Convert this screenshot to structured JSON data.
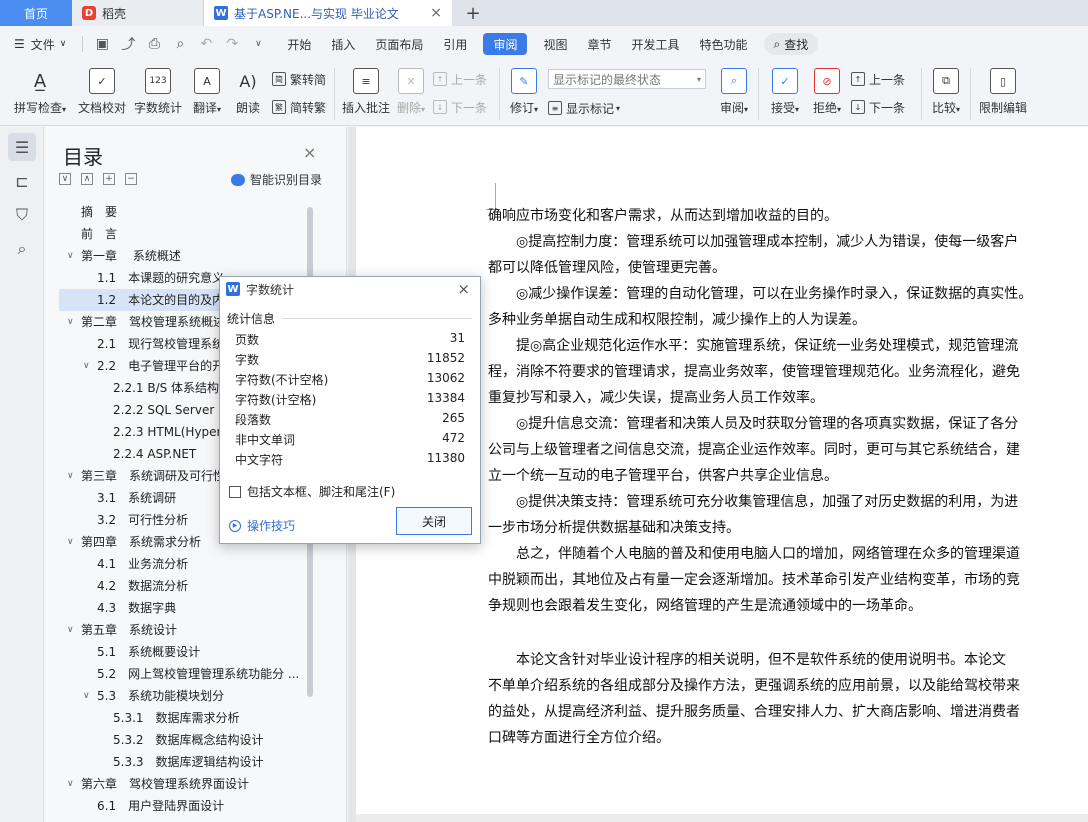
{
  "tabs": [
    {
      "label": "首页"
    },
    {
      "label": "稻壳"
    },
    {
      "label": "基于ASP.NE...与实现 毕业论文"
    }
  ],
  "menubar": {
    "file": "文件",
    "items": [
      "开始",
      "插入",
      "页面布局",
      "引用",
      "审阅",
      "视图",
      "章节",
      "开发工具",
      "特色功能"
    ],
    "active": "审阅",
    "search": "查找"
  },
  "ribbon": {
    "spell_check": "拼写检查",
    "doc_proof": "文档校对",
    "word_count": "字数统计",
    "translate": "翻译",
    "read_aloud": "朗读",
    "trad_to_simp": "繁转简",
    "simp_to_trad": "简转繁",
    "insert_comment": "插入批注",
    "delete": "删除",
    "prev_comment": "上一条",
    "next_comment": "下一条",
    "revise": "修订",
    "markup_select": "显示标记的最终状态",
    "show_markup": "显示标记",
    "review": "审阅",
    "accept": "接受",
    "reject": "拒绝",
    "prev": "上一条",
    "next": "下一条",
    "compare": "比较",
    "restrict_edit": "限制编辑"
  },
  "toc": {
    "title": "目录",
    "smart_label": "智能识别目录",
    "items": [
      {
        "text": "摘　要",
        "level": 1
      },
      {
        "text": "前　言",
        "level": 1
      },
      {
        "text": "第一章　 系统概述",
        "level": 1,
        "arrow": "∨"
      },
      {
        "text": "1.1　本课题的研究意义",
        "level": 2
      },
      {
        "text": "1.2　本论文的目的及内容",
        "level": 2,
        "selected": true
      },
      {
        "text": "第二章　驾校管理系统概述",
        "level": 1,
        "arrow": "∨"
      },
      {
        "text": "2.1　现行驾校管理系统",
        "level": 2
      },
      {
        "text": "2.2　电子管理平台的开",
        "level": 2,
        "arrow": "∨"
      },
      {
        "text": "2.2.1 B/S 体系结构",
        "level": 3
      },
      {
        "text": "2.2.2 SQL Server",
        "level": 3
      },
      {
        "text": "2.2.3 HTML(Hyper",
        "level": 3
      },
      {
        "text": "2.2.4 ASP.NET",
        "level": 3
      },
      {
        "text": "第三章　系统调研及可行性",
        "level": 1,
        "arrow": "∨"
      },
      {
        "text": "3.1　系统调研",
        "level": 2
      },
      {
        "text": "3.2　可行性分析",
        "level": 2
      },
      {
        "text": "第四章　系统需求分析",
        "level": 1,
        "arrow": "∨"
      },
      {
        "text": "4.1　业务流分析",
        "level": 2
      },
      {
        "text": "4.2　数据流分析",
        "level": 2
      },
      {
        "text": "4.3　数据字典",
        "level": 2
      },
      {
        "text": "第五章　系统设计",
        "level": 1,
        "arrow": "∨"
      },
      {
        "text": "5.1　系统概要设计",
        "level": 2
      },
      {
        "text": "5.2　网上驾校管理管理系统功能分 ...",
        "level": 2
      },
      {
        "text": "5.3　系统功能模块划分",
        "level": 2,
        "arrow": "∨"
      },
      {
        "text": "5.3.1　数据库需求分析",
        "level": 3
      },
      {
        "text": "5.3.2　数据库概念结构设计",
        "level": 3
      },
      {
        "text": "5.3.3　数据库逻辑结构设计",
        "level": 3
      },
      {
        "text": "第六章　驾校管理系统界面设计",
        "level": 1,
        "arrow": "∨"
      },
      {
        "text": "6.1　用户登陆界面设计",
        "level": 2
      }
    ]
  },
  "document": {
    "lines": [
      "确响应市场变化和客户需求，从而达到增加收益的目的。",
      "　　◎提高控制力度：管理系统可以加强管理成本控制，减少人为错误，使每一级客户",
      "都可以降低管理风险，使管理更完善。",
      "　　◎减少操作误差：管理的自动化管理，可以在业务操作时录入，保证数据的真实性。",
      "多种业务单据自动生成和权限控制，减少操作上的人为误差。",
      "　　提◎高企业规范化运作水平：实施管理系统，保证统一业务处理模式，规范管理流",
      "程，消除不符要求的管理请求，提高业务效率，使管理管理规范化。业务流程化，避免",
      "重复抄写和录入，减少失误，提高业务人员工作效率。",
      "　　◎提升信息交流：管理者和决策人员及时获取分管理的各项真实数据，保证了各分",
      "公司与上级管理者之间信息交流，提高企业运作效率。同时，更可与其它系统结合，建",
      "立一个统一互动的电子管理平台，供客户共享企业信息。",
      "　　◎提供决策支持：管理系统可充分收集管理信息，加强了对历史数据的利用，为进",
      "一步市场分析提供数据基础和决策支持。",
      "　　总之，伴随着个人电脑的普及和使用电脑人口的增加，网络管理在众多的管理渠道",
      "中脱颖而出，其地位及占有量一定会逐渐增加。技术革命引发产业结构变革，市场的竞",
      "争规则也会跟着发生变化，网络管理的产生是流通领域中的一场革命。",
      "",
      "　　本论文含针对毕业设计程序的相关说明，但不是软件系统的使用说明书。本论文",
      "不单单介绍系统的各组成部分及操作方法，更强调系统的应用前景，以及能给驾校带来",
      "的益处，从提高经济利益、提升服务质量、合理安排人力、扩大商店影响、增进消费者",
      "口碑等方面进行全方位介绍。"
    ]
  },
  "dialog": {
    "title": "字数统计",
    "section": "统计信息",
    "stats": [
      {
        "label": "页数",
        "value": "31"
      },
      {
        "label": "字数",
        "value": "11852"
      },
      {
        "label": "字符数(不计空格)",
        "value": "13062"
      },
      {
        "label": "字符数(计空格)",
        "value": "13384"
      },
      {
        "label": "段落数",
        "value": "265"
      },
      {
        "label": "非中文单词",
        "value": "472"
      },
      {
        "label": "中文字符",
        "value": "11380"
      }
    ],
    "checkbox_label": "包括文本框、脚注和尾注(F)",
    "tips": "操作技巧",
    "close": "关闭"
  }
}
